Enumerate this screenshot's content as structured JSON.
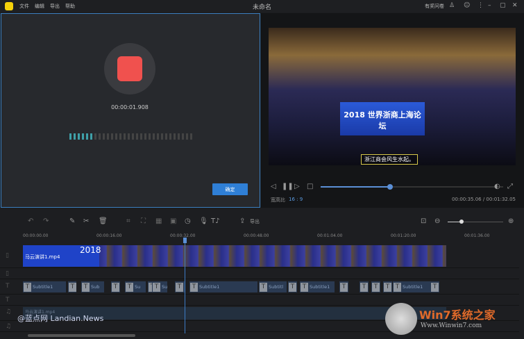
{
  "titlebar": {
    "title": "未命名",
    "menus": [
      "文件",
      "编辑",
      "导出",
      "帮助"
    ],
    "feedback": "有奖问卷",
    "icons": [
      "user-icon",
      "chat-icon",
      "more-icon",
      "minimize-icon",
      "maximize-icon",
      "close-icon"
    ]
  },
  "recorder": {
    "elapsed": "00:00:01.908",
    "level_on": 6,
    "level_total": 30,
    "confirm_label": "确定"
  },
  "preview": {
    "screen_text": "2018 世界浙商上海论坛",
    "caption": "浙江商会风生水起。",
    "aspect_label": "宽高比",
    "aspect_value": "16 : 9",
    "current_time": "00:00:35.06",
    "total_time": "00:01:32.05",
    "time_display": "00:00:35.06 / 00:01:32.05",
    "progress": 0.38
  },
  "toolbar": {
    "export_label": "导出",
    "zoom_level": 0.25
  },
  "ruler": [
    "00:00:00.00",
    "00:00:16.00",
    "00:00:32.00",
    "00:00:48.00",
    "00:01:04.00",
    "00:01:20.00",
    "00:01:36.00"
  ],
  "tracks": {
    "video_clip": "马云演讲1.mp4",
    "video_text": "2018",
    "audio_clip": "马云演讲1.mp4",
    "subtitles": [
      {
        "label": "Subtitle1"
      },
      {
        "label": ""
      },
      {
        "label": "Sub"
      },
      {
        "label": ""
      },
      {
        "label": "Su"
      },
      {
        "label": ""
      },
      {
        "label": "Su"
      },
      {
        "label": ""
      },
      {
        "label": "Subtitle1"
      },
      {
        "label": "Subtitl"
      },
      {
        "label": ""
      },
      {
        "label": "Subtitle1"
      },
      {
        "label": ""
      },
      {
        "label": ""
      },
      {
        "label": ""
      },
      {
        "label": ""
      },
      {
        "label": "Subtitle1"
      },
      {
        "label": ""
      }
    ]
  },
  "watermarks": {
    "landian": "@蓝点网 Landian.News",
    "win7": "Win7系统之家",
    "win7_url": "Www.Winwin7.com"
  }
}
